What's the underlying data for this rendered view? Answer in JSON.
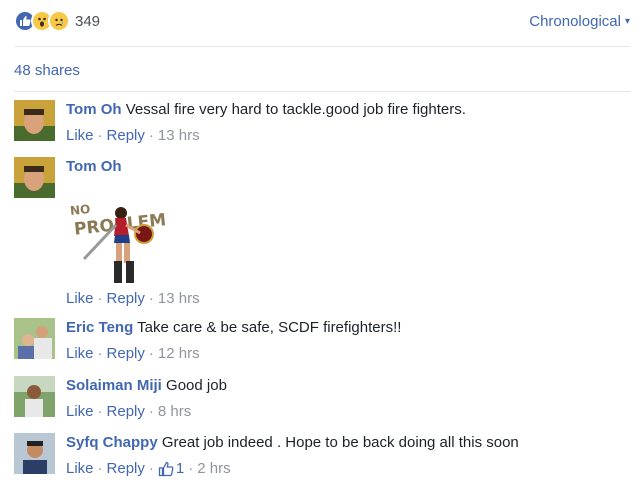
{
  "reactions": {
    "icons": [
      "like-icon",
      "wow-icon",
      "sad-icon"
    ],
    "count": "349"
  },
  "sort": {
    "label": "Chronological",
    "caret": "▾"
  },
  "shares": {
    "label": "48 shares"
  },
  "actions": {
    "like": "Like",
    "reply": "Reply",
    "separator": "·"
  },
  "comments": [
    {
      "author": "Tom Oh",
      "text": "Vessal fire very hard to tackle.good job fire fighters.",
      "time": "13 hrs"
    },
    {
      "author": "Tom Oh",
      "text": "",
      "sticker_text": [
        "NO",
        "PROBLEM"
      ],
      "time": "13 hrs"
    },
    {
      "author": "Eric Teng",
      "text": "Take care & be safe, SCDF firefighters!!",
      "time": "12 hrs"
    },
    {
      "author": "Solaiman Miji",
      "text": "Good job",
      "time": "8 hrs"
    },
    {
      "author": "Syfq Chappy",
      "text": "Great job indeed . Hope to be back doing all this soon",
      "likes": "1",
      "time": "2 hrs"
    }
  ],
  "colors": {
    "link": "#4267b2",
    "meta": "#90949c",
    "text": "#1d2129",
    "divider": "#e5e6eb"
  }
}
